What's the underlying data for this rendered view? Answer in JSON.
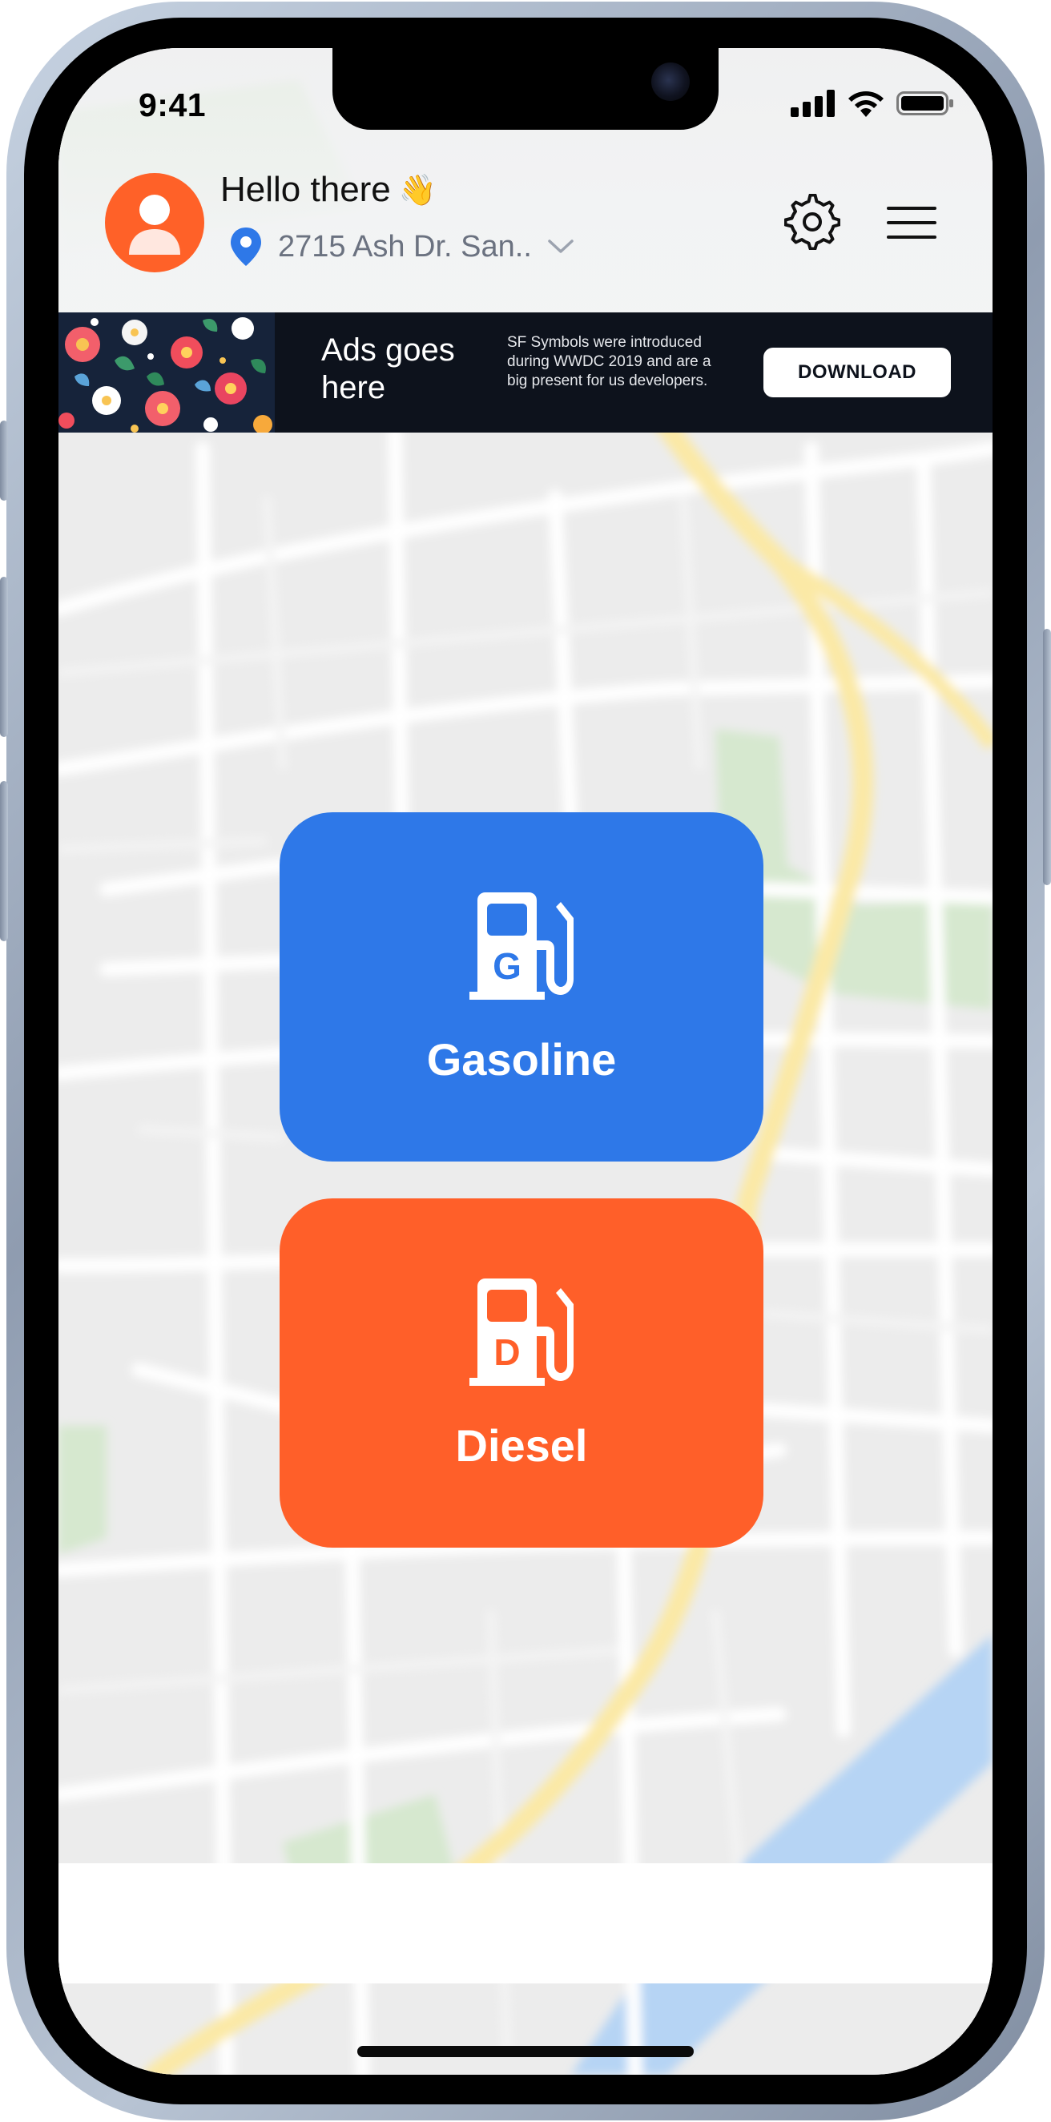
{
  "status_bar": {
    "time": "9:41",
    "icons": [
      "cellular-signal-icon",
      "wifi-icon",
      "battery-icon"
    ]
  },
  "header": {
    "greeting": "Hello there",
    "greeting_emoji": "👋",
    "location": "2715 Ash Dr. San..",
    "icons": [
      "avatar-icon",
      "location-pin-icon",
      "chevron-down-icon",
      "gear-icon",
      "hamburger-menu-icon"
    ]
  },
  "ad_banner": {
    "title": "Ads goes here",
    "description": "SF Symbols were introduced during WWDC 2019 and are a big present for us developers.",
    "button_label": "DOWNLOAD"
  },
  "fuel_options": [
    {
      "label": "Gasoline",
      "icon_letter": "G",
      "icon": "fuel-pump-icon",
      "color": "#2E78E8"
    },
    {
      "label": "Diesel",
      "icon_letter": "D",
      "icon": "fuel-pump-icon",
      "color": "#FF5F29"
    }
  ],
  "colors": {
    "accent_orange": "#FF6128",
    "accent_blue": "#2E78E8",
    "ad_background": "#0D121C"
  }
}
